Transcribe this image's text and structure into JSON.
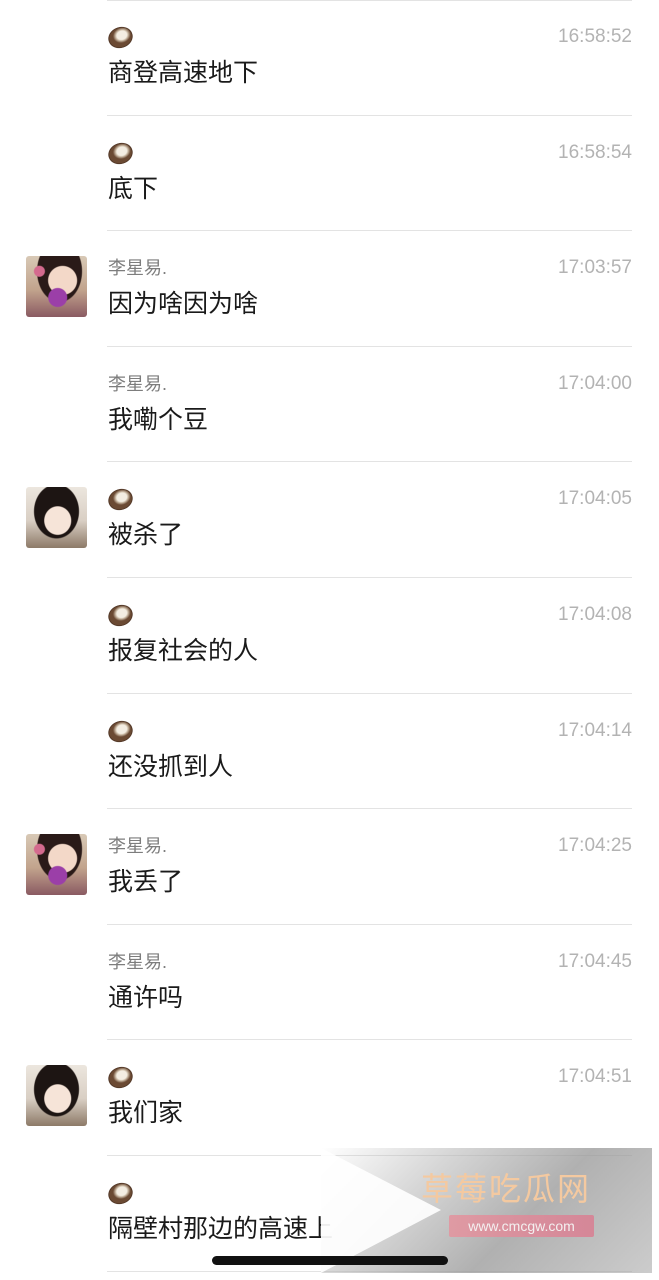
{
  "messages": [
    {
      "sender": "",
      "sender_icon": "coconut-icon",
      "avatar": "",
      "time": "16:58:52",
      "text": "商登高速地下"
    },
    {
      "sender": "",
      "sender_icon": "coconut-icon",
      "avatar": "",
      "time": "16:58:54",
      "text": "底下"
    },
    {
      "sender": "李星易.",
      "sender_icon": "",
      "avatar": "a1",
      "time": "17:03:57",
      "text": "因为啥因为啥"
    },
    {
      "sender": "李星易.",
      "sender_icon": "",
      "avatar": "",
      "time": "17:04:00",
      "text": "我嘞个豆"
    },
    {
      "sender": "",
      "sender_icon": "coconut-icon",
      "avatar": "a2",
      "time": "17:04:05",
      "text": "被杀了"
    },
    {
      "sender": "",
      "sender_icon": "coconut-icon",
      "avatar": "",
      "time": "17:04:08",
      "text": "报复社会的人"
    },
    {
      "sender": "",
      "sender_icon": "coconut-icon",
      "avatar": "",
      "time": "17:04:14",
      "text": "还没抓到人"
    },
    {
      "sender": "李星易.",
      "sender_icon": "",
      "avatar": "a1",
      "time": "17:04:25",
      "text": "我丢了"
    },
    {
      "sender": "李星易.",
      "sender_icon": "",
      "avatar": "",
      "time": "17:04:45",
      "text": "通许吗"
    },
    {
      "sender": "",
      "sender_icon": "coconut-icon",
      "avatar": "a2",
      "time": "17:04:51",
      "text": "我们家"
    },
    {
      "sender": "",
      "sender_icon": "coconut-icon",
      "avatar": "",
      "time": "",
      "text": "隔壁村那边的高速上"
    }
  ],
  "watermark": {
    "title": "草莓吃瓜网",
    "url": "www.cmcgw.com"
  },
  "colors": {
    "background": "#ffffff",
    "message_text": "#1a1a1a",
    "sender_text": "#7d7d7d",
    "time_text": "#b3b3b3",
    "divider": "#e3e3e3"
  }
}
